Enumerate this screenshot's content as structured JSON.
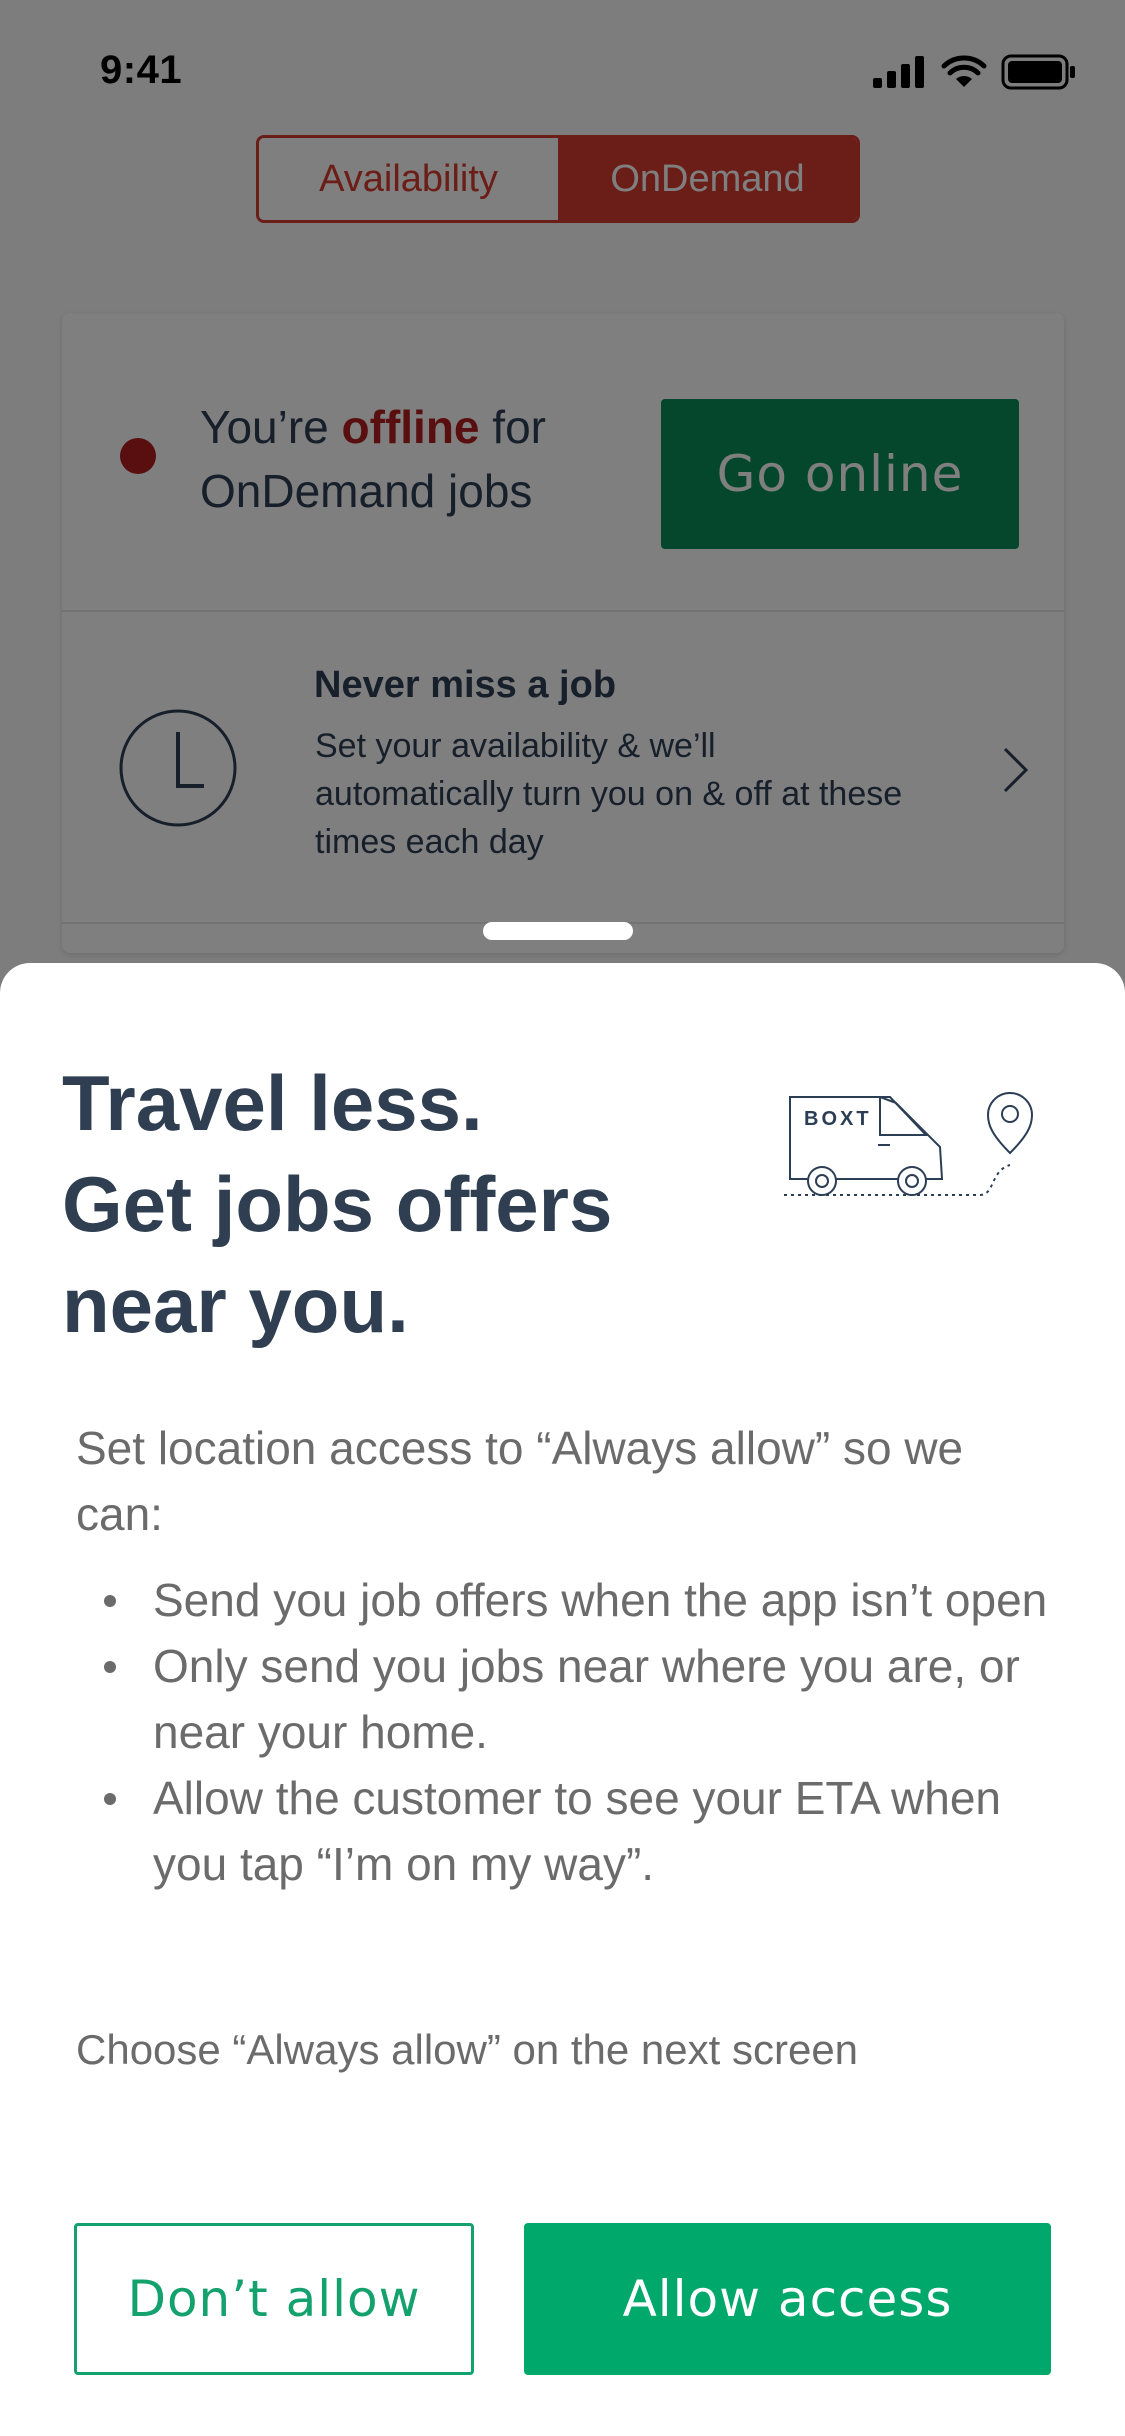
{
  "status_bar": {
    "time": "9:41",
    "icons": [
      "signal-icon",
      "wifi-icon",
      "battery-icon"
    ]
  },
  "mode_toggle": {
    "options": [
      "Availability",
      "OnDemand"
    ],
    "selected": "OnDemand",
    "accent_color": "#d63b2e"
  },
  "status_card": {
    "text_prefix": "You’re ",
    "text_status": "offline",
    "text_suffix_1": " for",
    "text_suffix_2": "OnDemand jobs",
    "status_color": "#b21f1f",
    "go_online_label": "Go online",
    "go_online_color": "#0b8f5a"
  },
  "availability_card": {
    "title": "Never miss a job",
    "description": "Set your availability & we’ll automatically turn you on & off at these times each day",
    "icon": "clock-icon"
  },
  "sheet": {
    "title": "Travel less.\nGet jobs offers\nnear you.",
    "illustration_label": "BOXT",
    "intro": "Set location access to “Always allow” so we can:",
    "bullets": [
      "Send you job offers when the app isn’t open",
      "Only send you jobs near where you are, or near your home.",
      "Allow the customer to see your ETA when you tap “I’m on my way”."
    ],
    "hint": "Choose “Always allow” on the next screen",
    "dont_allow_label": "Don’t allow",
    "allow_access_label": "Allow access",
    "primary_color": "#00a86b"
  }
}
